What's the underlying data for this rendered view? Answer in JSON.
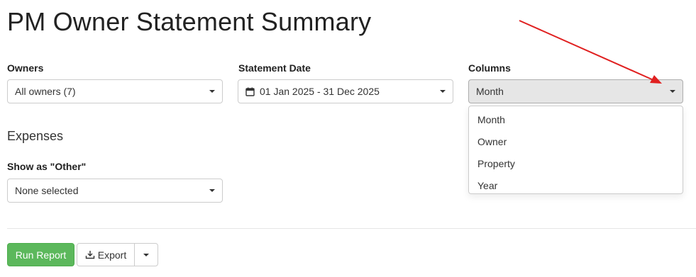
{
  "page": {
    "title": "PM Owner Statement Summary"
  },
  "filters": {
    "owners": {
      "label": "Owners",
      "value": "All owners (7)"
    },
    "statement_date": {
      "label": "Statement Date",
      "value": "01 Jan 2025 - 31 Dec 2025"
    },
    "columns": {
      "label": "Columns",
      "value": "Month",
      "options": [
        "Month",
        "Owner",
        "Property",
        "Year"
      ]
    }
  },
  "expenses": {
    "heading": "Expenses",
    "show_as_other": {
      "label": "Show as \"Other\"",
      "value": "None selected"
    }
  },
  "actions": {
    "run_report": "Run Report",
    "export": "Export"
  },
  "icons": {
    "dropdown": "caret-down-icon",
    "date": "calendar-icon",
    "export": "download-icon",
    "annotation": "red-arrow"
  },
  "colors": {
    "primary": "#5cb85c",
    "annotation_arrow": "#e02020"
  }
}
